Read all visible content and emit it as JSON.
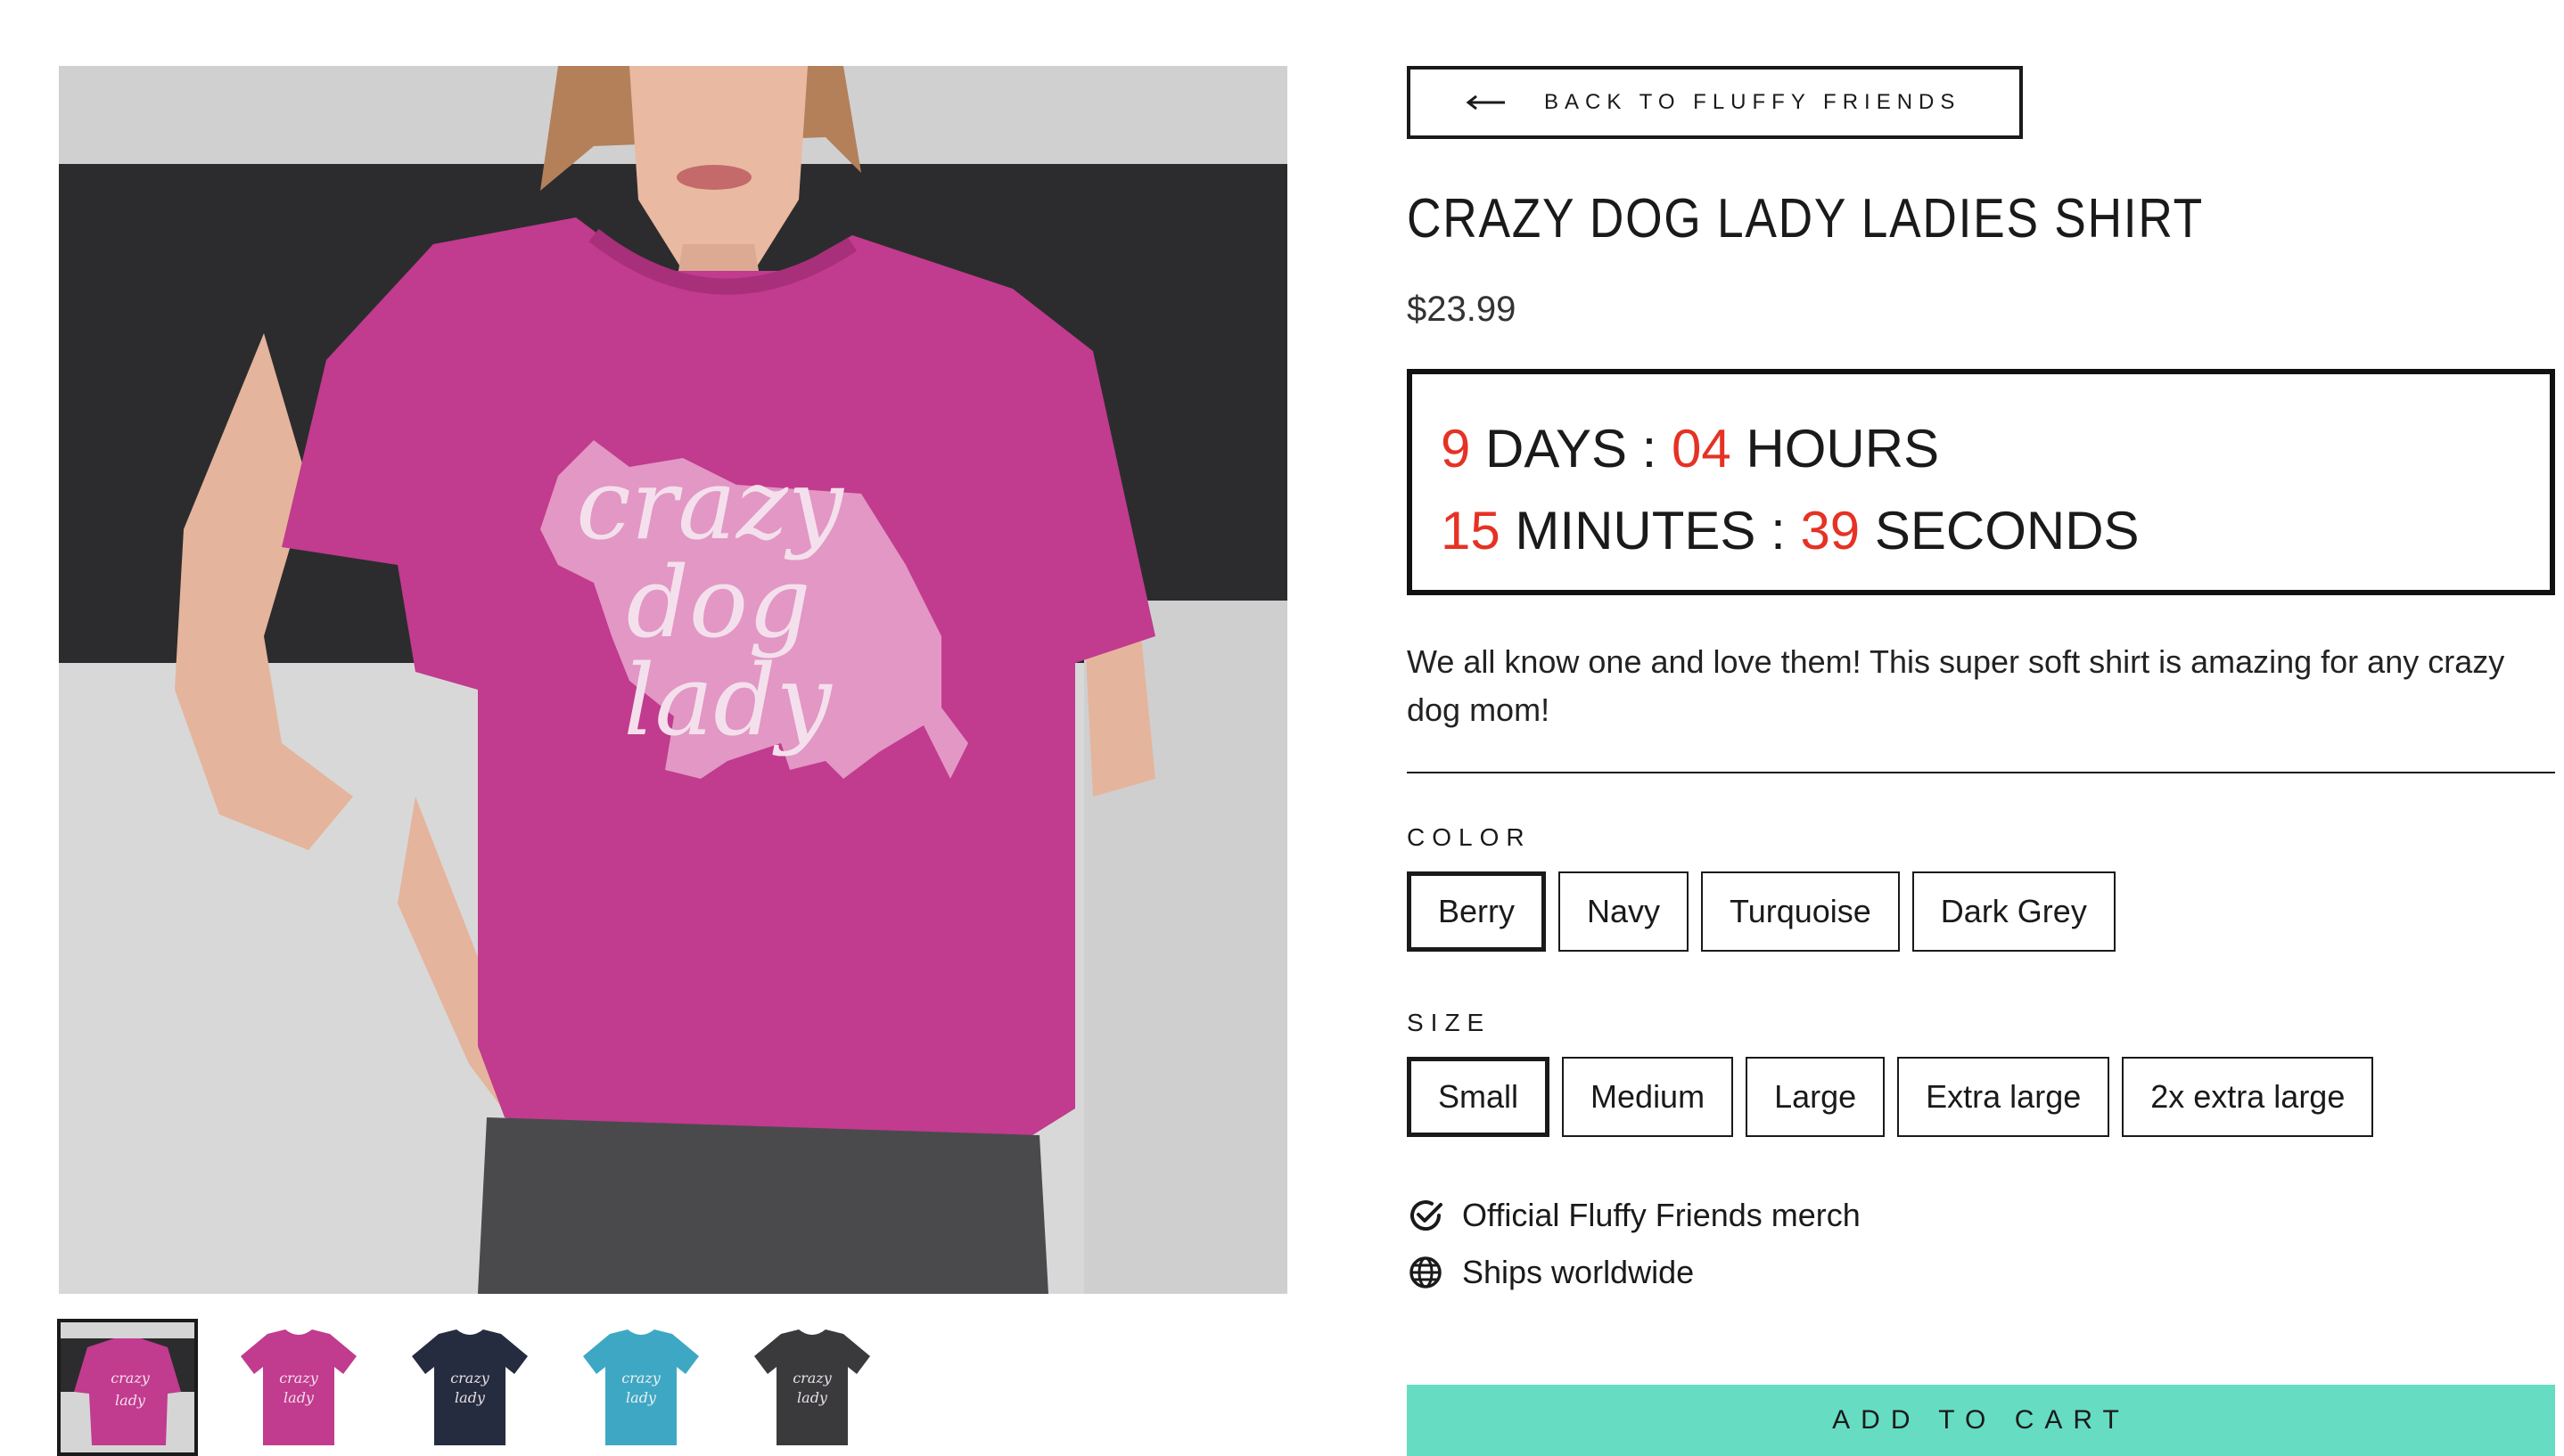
{
  "back_button": {
    "label": "BACK TO FLUFFY FRIENDS"
  },
  "product": {
    "title": "CRAZY DOG LADY LADIES SHIRT",
    "price": "$23.99",
    "description": "We all know one and love them! This super soft shirt is amazing for any crazy dog mom!"
  },
  "countdown": {
    "days": "9",
    "days_label": "DAYS :",
    "hours": "04",
    "hours_label": "HOURS",
    "minutes": "15",
    "minutes_label": "MINUTES :",
    "seconds": "39",
    "seconds_label": "SECONDS",
    "accent_color": "#e53224"
  },
  "options": {
    "color": {
      "label": "COLOR",
      "values": [
        "Berry",
        "Navy",
        "Turquoise",
        "Dark Grey"
      ],
      "selected": "Berry"
    },
    "size": {
      "label": "SIZE",
      "values": [
        "Small",
        "Medium",
        "Large",
        "Extra large",
        "2x extra large"
      ],
      "selected": "Small"
    }
  },
  "features": [
    {
      "icon": "check-circle-icon",
      "text": "Official Fluffy Friends merch"
    },
    {
      "icon": "globe-icon",
      "text": "Ships worldwide"
    }
  ],
  "add_to_cart": {
    "label": "ADD TO CART",
    "color": "#66dcc2"
  },
  "gallery": {
    "shirt_print": [
      "crazy",
      "dog",
      "lady"
    ],
    "thumbnails": [
      {
        "name": "lifestyle-berry",
        "color": "#c13b8e",
        "active": true
      },
      {
        "name": "berry",
        "color": "#c13b8e",
        "active": false
      },
      {
        "name": "navy",
        "color": "#262c3f",
        "active": false
      },
      {
        "name": "turquoise",
        "color": "#3ea8c4",
        "active": false
      },
      {
        "name": "dark-grey",
        "color": "#3a3a3d",
        "active": false
      }
    ]
  }
}
